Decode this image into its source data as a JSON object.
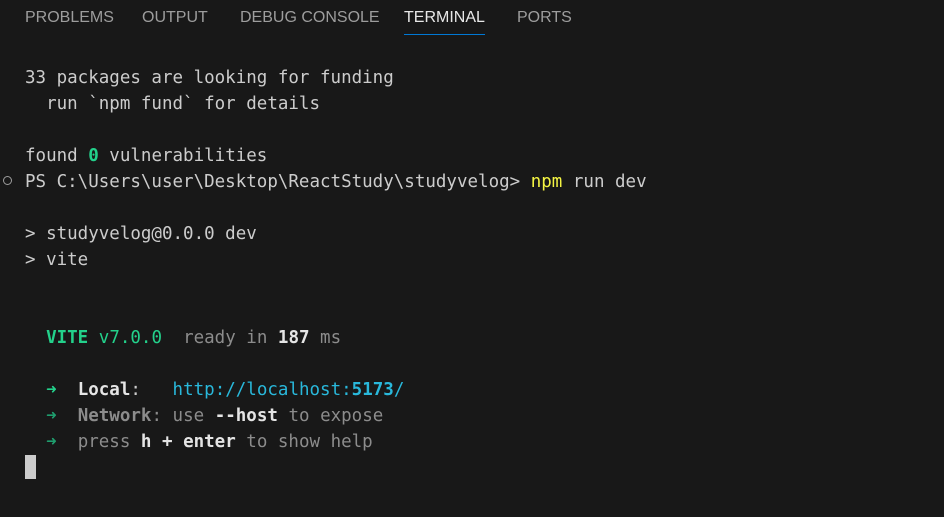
{
  "tabs": [
    {
      "label": "PROBLEMS"
    },
    {
      "label": "OUTPUT"
    },
    {
      "label": "DEBUG CONSOLE"
    },
    {
      "label": "TERMINAL",
      "active": true
    },
    {
      "label": "PORTS"
    }
  ],
  "terminal": {
    "funding_line": "33 packages are looking for funding",
    "fund_hint": "  run `npm fund` for details",
    "found_prefix": "found ",
    "vuln_count": "0",
    "vuln_suffix": " vulnerabilities",
    "prompt": "PS C:\\Users\\user\\Desktop\\ReactStudy\\studyvelog> ",
    "command_npm": "npm",
    "command_rest": " run dev",
    "script_line1": "> studyvelog@0.0.0 dev",
    "script_line2": "> vite",
    "vite_name": "VITE",
    "vite_version": "v7.0.0",
    "ready_text": "ready in ",
    "ready_time": "187",
    "ready_unit": " ms",
    "arrow": "➜",
    "local_label": "Local",
    "local_colon": ":",
    "local_url_prefix": "http://localhost:",
    "local_port": "5173",
    "local_url_suffix": "/",
    "network_label": "Network",
    "network_colon": ":",
    "network_use": " use ",
    "network_flag": "--host",
    "network_suffix": " to expose",
    "help_press": "press ",
    "help_key": "h + enter",
    "help_suffix": " to show help"
  },
  "colors": {
    "background": "#181818",
    "success_green": "#23d18b",
    "command_yellow": "#f5f543",
    "url_cyan": "#29b8db",
    "active_tab_underline": "#0078d4"
  },
  "icons": {
    "command_decoration": "circle-outline-icon",
    "cursor": "block-cursor"
  }
}
